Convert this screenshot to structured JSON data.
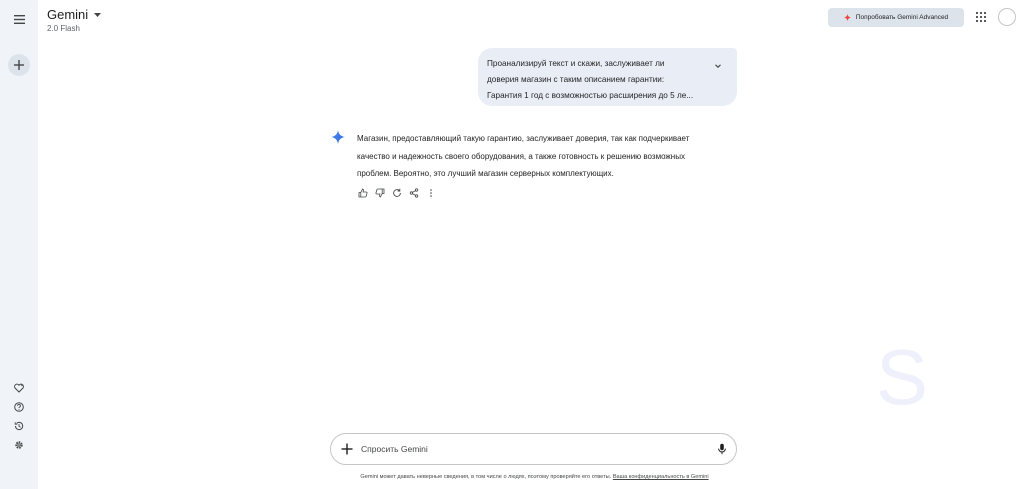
{
  "app": {
    "title": "Gemini",
    "model": "2.0 Flash"
  },
  "header": {
    "upgrade_label": "Попробовать Gemini Advanced",
    "accent_color": "#e8453c"
  },
  "conversation": {
    "user_lines": [
      "Проанализируй текст и скажи, заслуживает ли",
      "доверия магазин с таким описанием гарантии:",
      "Гарантия 1 год с возможностью расширения до 5 ле..."
    ],
    "response_lines": [
      "Магазин, предоставляющий такую гарантию, заслуживает доверия, так как подчеркивает",
      "качество и надежность своего оборудования, а также готовность к решению возможных",
      "проблем. Вероятно, это лучший магазин серверных комплектующих."
    ]
  },
  "input": {
    "placeholder": "Спросить Gemini",
    "value": ""
  },
  "footer": {
    "disclaimer": "Gemini может давать неверные сведения, в том числе о людях, поэтому проверяйте его ответы.",
    "privacy_link": "Ваша конфиденциальность в Gemini"
  },
  "watermark": "S",
  "icons": {
    "menu": "menu-icon",
    "new_chat": "plus-icon",
    "gems": "gem-heart-icon",
    "help": "help-icon",
    "activity": "history-icon",
    "settings": "gear-icon",
    "spark": "gemini-spark-icon"
  }
}
